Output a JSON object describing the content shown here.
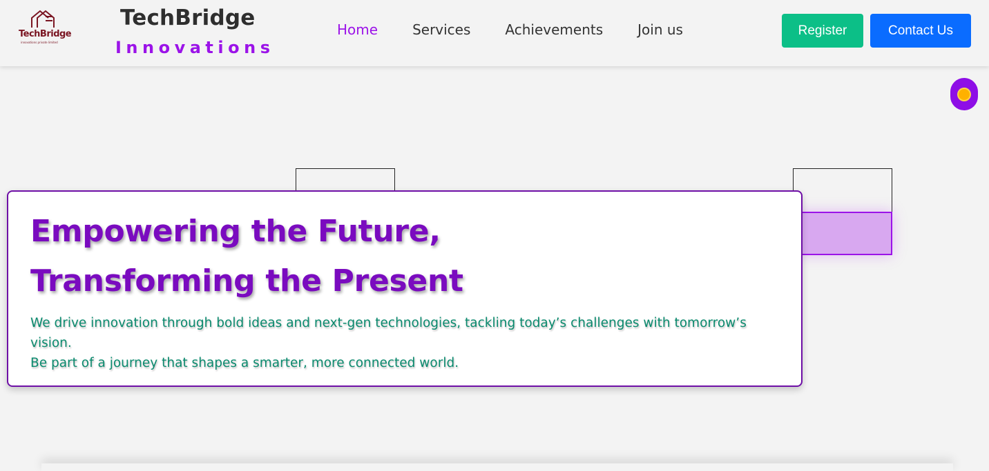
{
  "logo": {
    "name": "TechBridge",
    "tagline": "innovations private limited",
    "icon": "house-outline-icon"
  },
  "brand": {
    "title": "TechBridge",
    "subtitle": "Innovations"
  },
  "nav": {
    "items": [
      {
        "label": "Home",
        "active": true
      },
      {
        "label": "Services",
        "active": false
      },
      {
        "label": "Achievements",
        "active": false
      },
      {
        "label": "Join us",
        "active": false
      }
    ]
  },
  "actions": {
    "register_label": "Register",
    "contact_label": "Contact Us"
  },
  "theme_toggle": {
    "icon": "sun-icon"
  },
  "hero": {
    "title_line1": "Empowering the Future,",
    "title_line2": "Transforming the Present",
    "text_line1": "We drive innovation through bold ideas and next-gen technologies, tackling today’s challenges with tomorrow’s vision.",
    "text_line2": "Be part of a journey that shapes a smarter, more connected world."
  },
  "colors": {
    "accent": "#9b13e8",
    "hero_title": "#7a0bbf",
    "hero_text": "#0b8a6e",
    "register": "#0cbf87",
    "contact": "#0a6cff"
  }
}
